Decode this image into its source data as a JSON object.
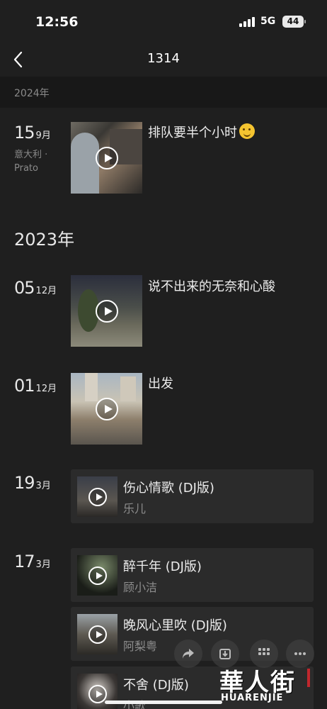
{
  "status_bar": {
    "time": "12:56",
    "network": "5G",
    "battery": "44"
  },
  "nav": {
    "title": "1314"
  },
  "sections": {
    "year_2024": "2024年",
    "year_2023": "2023年"
  },
  "entries": [
    {
      "day": "15",
      "month": "9月",
      "location_line1": "意大利 ·",
      "location_line2": "Prato",
      "caption": "排队要半个小时"
    },
    {
      "day": "05",
      "month": "12月",
      "caption": "说不出来的无奈和心酸"
    },
    {
      "day": "01",
      "month": "12月",
      "caption": "出发"
    },
    {
      "day": "19",
      "month": "3月",
      "music_title": "伤心情歌 (DJ版)",
      "music_artist": "乐儿"
    },
    {
      "day": "17",
      "month": "3月",
      "songs": [
        {
          "title": "醉千年 (DJ版)",
          "artist": "顾小洁"
        },
        {
          "title": "晚风心里吹 (DJ版)",
          "artist": "阿梨粤"
        },
        {
          "title": "不舍 (DJ版)",
          "artist": "小歌"
        }
      ]
    }
  ],
  "watermark": {
    "text": "華人街",
    "sub": "HUARENJIE"
  },
  "colors": {
    "background": "#1f1f1f",
    "card": "#2b2b2b",
    "band": "#181818"
  },
  "icons": [
    "back-icon",
    "play-icon",
    "share-icon",
    "download-icon",
    "grid-icon",
    "more-icon"
  ]
}
